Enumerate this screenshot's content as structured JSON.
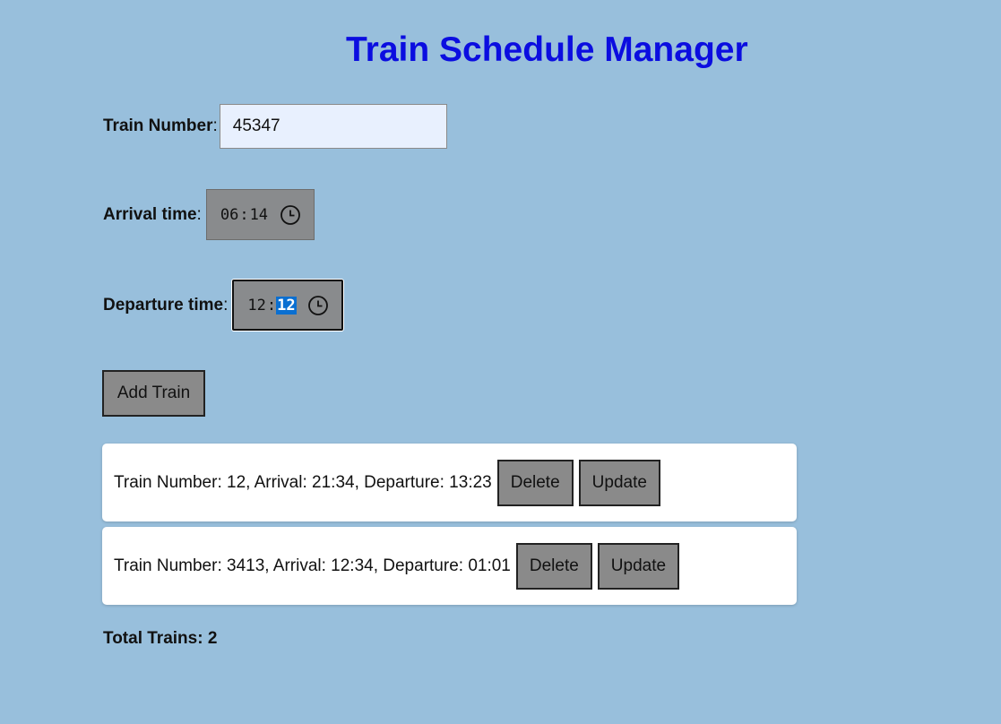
{
  "header": {
    "title": "Train Schedule Manager"
  },
  "form": {
    "train_number": {
      "label": "Train Number",
      "separator": ":",
      "value": "45347"
    },
    "arrival": {
      "label": "Arrival time",
      "separator": ":",
      "hours": "06",
      "minutes": "14"
    },
    "departure": {
      "label": "Departure time",
      "separator": ":",
      "hours": "12",
      "minutes": "12"
    },
    "clock_icon": "clock-icon",
    "add_button": "Add Train"
  },
  "trains": [
    {
      "text": "Train Number: 12, Arrival: 21:34, Departure: 13:23",
      "delete_label": "Delete",
      "update_label": "Update"
    },
    {
      "text": "Train Number: 3413, Arrival: 12:34, Departure: 01:01",
      "delete_label": "Delete",
      "update_label": "Update"
    }
  ],
  "summary": {
    "total_text": "Total Trains: 2"
  },
  "colors": {
    "background": "#98bfdc",
    "title": "#0b0de0",
    "button": "#8a8a8a",
    "input_background": "#e8f0fe",
    "selection": "#0a6fd1"
  }
}
